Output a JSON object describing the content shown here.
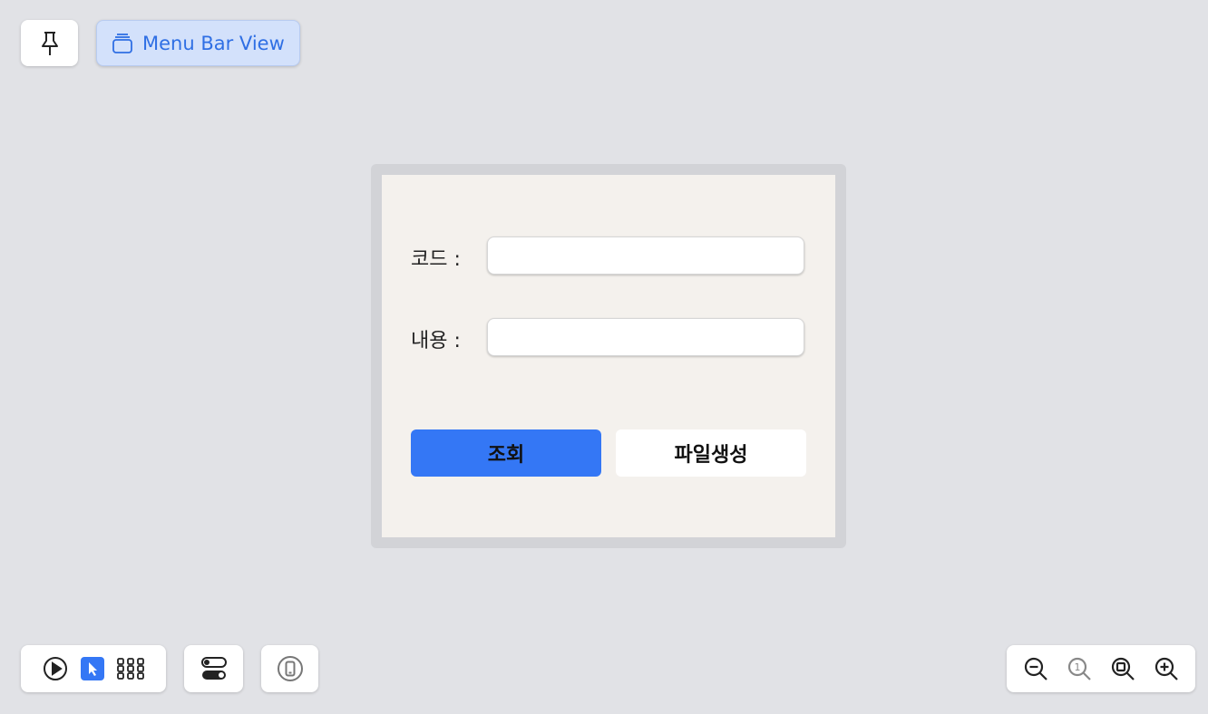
{
  "top": {
    "pin_icon": "pin-icon",
    "menu_bar_view": {
      "label": "Menu Bar View",
      "icon": "windows-stack-icon",
      "accent": "#2f6fe4"
    }
  },
  "form": {
    "code": {
      "label": "코드 :",
      "value": ""
    },
    "content": {
      "label": "내용 :",
      "value": ""
    },
    "query_button": {
      "label": "조회",
      "color": "#3477f5"
    },
    "file_button": {
      "label": "파일생성"
    }
  },
  "bottom_left": {
    "icons": [
      "play-icon",
      "cursor-icon",
      "grid-icon"
    ],
    "toggle_icon": "toggles-icon",
    "device_icon": "phone-icon"
  },
  "zoom": {
    "icons": [
      "zoom-out-icon",
      "zoom-actual-size-icon",
      "zoom-fit-icon",
      "zoom-in-icon"
    ],
    "actual_size_label": "1"
  }
}
